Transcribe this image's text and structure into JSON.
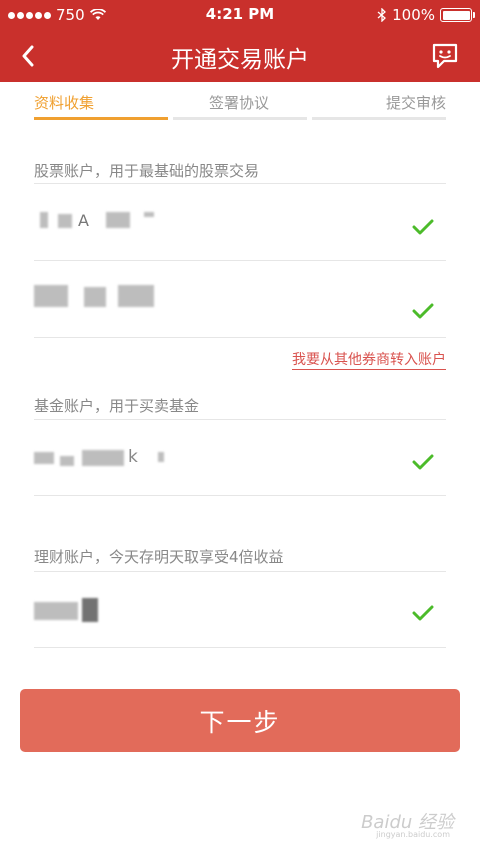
{
  "status_bar": {
    "carrier": "750",
    "time": "4:21 PM",
    "battery": "100%",
    "battery_level": 1.0
  },
  "nav": {
    "title": "开通交易账户",
    "back_icon": "chevron-left-icon",
    "chat_icon": "chat-bubble-icon"
  },
  "steps": [
    {
      "label": "资料收集",
      "active": true
    },
    {
      "label": "签署协议",
      "active": false
    },
    {
      "label": "提交审核",
      "active": false
    }
  ],
  "sections": {
    "stock": {
      "label": "股票账户，用于最基础的股票交易"
    },
    "transfer_link": "我要从其他券商转入账户",
    "fund": {
      "label": "基金账户，用于买卖基金"
    },
    "wealth": {
      "label": "理财账户，今天存明天取享受4倍收益"
    }
  },
  "rows": {
    "stock_1": {
      "visible_char": "A"
    },
    "fund_1": {
      "visible_char": "k"
    }
  },
  "next_button": "下一步",
  "watermark": {
    "text": "Baidu 经验",
    "sub": "jingyan.baidu.com"
  },
  "colors": {
    "brand_red": "#c9302c",
    "step_active": "#f0a030",
    "check_green": "#4cbb2a",
    "button": "#e26b5a"
  }
}
